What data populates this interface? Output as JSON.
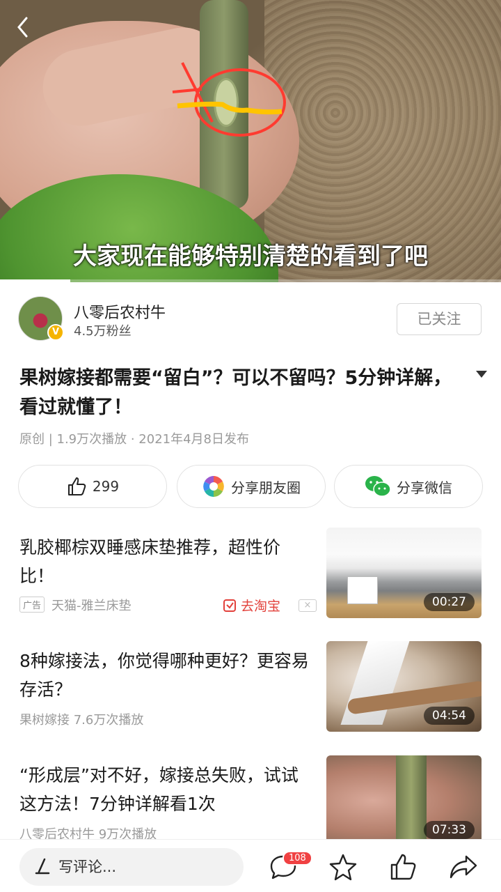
{
  "video": {
    "subtitle": "大家现在能够特别清楚的看到了吧",
    "progress_fraction": 0.14,
    "back_icon": "chevron-left-icon"
  },
  "author": {
    "name": "八零后农村牛",
    "fans": "4.5万粉丝",
    "verified_badge": "V",
    "follow_label": "已关注"
  },
  "article": {
    "title": "果树嫁接都需要“留白”？可以不留吗？5分钟详解，看过就懂了！",
    "meta": "原创 | 1.9万次播放 · 2021年4月8日发布"
  },
  "actions": {
    "like_count": "299",
    "share_moments": "分享朋友圈",
    "share_wechat": "分享微信"
  },
  "feed": [
    {
      "title": "乳胶椰棕双睡感床垫推荐，超性价比！",
      "ad_tag": "广告",
      "source": "天猫-雅兰床垫",
      "cta": "去淘宝",
      "close": "×",
      "duration": "00:27"
    },
    {
      "title": "8种嫁接法，你觉得哪种更好？更容易存活？",
      "meta": "果树嫁接   7.6万次播放",
      "duration": "04:54"
    },
    {
      "title": "“形成层”对不好，嫁接总失败，试试这方法！7分钟详解看1次",
      "meta": "八零后农村牛   9万次播放",
      "duration": "07:33"
    }
  ],
  "bottom": {
    "comment_placeholder": "写评论...",
    "comment_count": "108"
  },
  "colors": {
    "accent_red": "#f04142",
    "verified_yellow": "#f5b400",
    "taobao_red": "#e2403a"
  }
}
